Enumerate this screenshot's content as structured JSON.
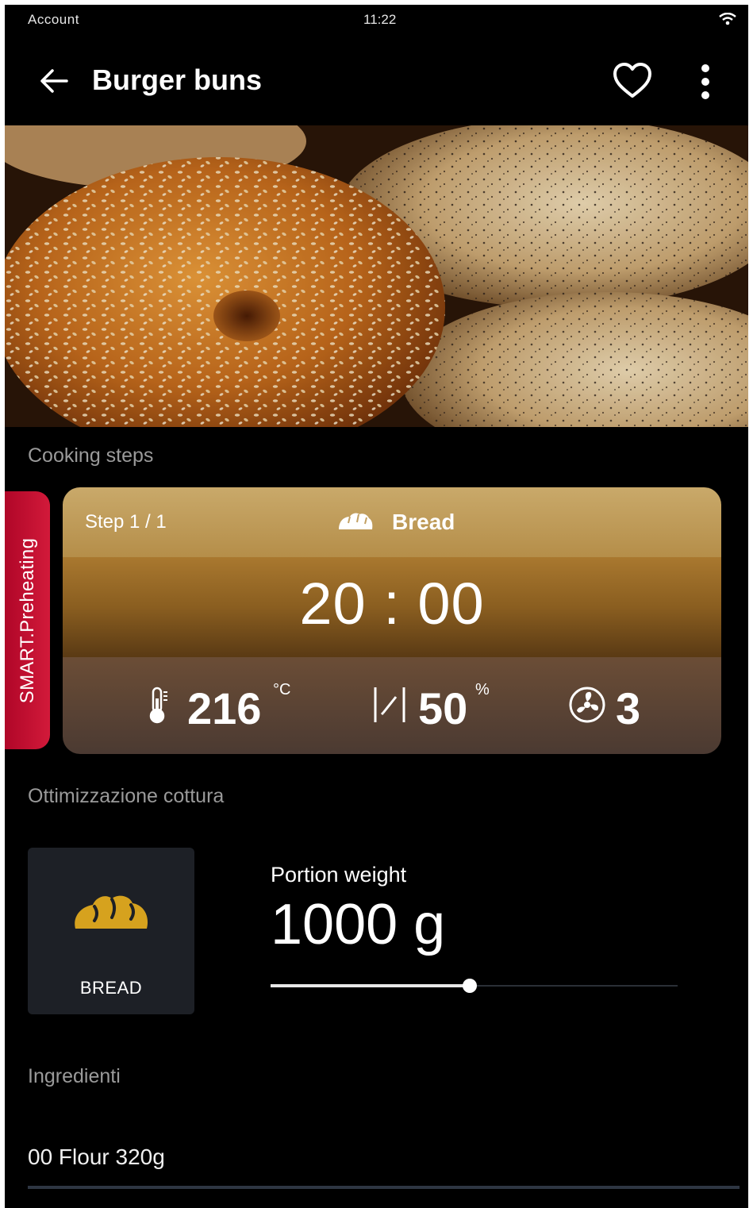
{
  "status_bar": {
    "account": "Account",
    "time": "11:22"
  },
  "header": {
    "title": "Burger buns"
  },
  "sections": {
    "cooking_steps": "Cooking steps",
    "optimization": "Ottimizzazione cottura",
    "ingredients": "Ingredienti"
  },
  "smart_tab": {
    "label": "SMART.Preheating"
  },
  "step_card": {
    "step": "Step 1 / 1",
    "program": "Bread",
    "time": "20 : 00",
    "temperature": {
      "value": "216",
      "unit": "°C"
    },
    "humidity": {
      "value": "50",
      "unit": "%"
    },
    "fan": {
      "value": "3"
    }
  },
  "optimization": {
    "tile_label": "BREAD",
    "portion_label": "Portion weight",
    "portion_value": "1000 g",
    "slider_fraction": 0.49
  },
  "ingredients": [
    {
      "text": "00 Flour 320g"
    }
  ],
  "colors": {
    "smart_red": "#c8102e",
    "card_gold": "#c9a96a",
    "bread_icon": "#d6a21e",
    "tile_bg": "#1d2026"
  }
}
